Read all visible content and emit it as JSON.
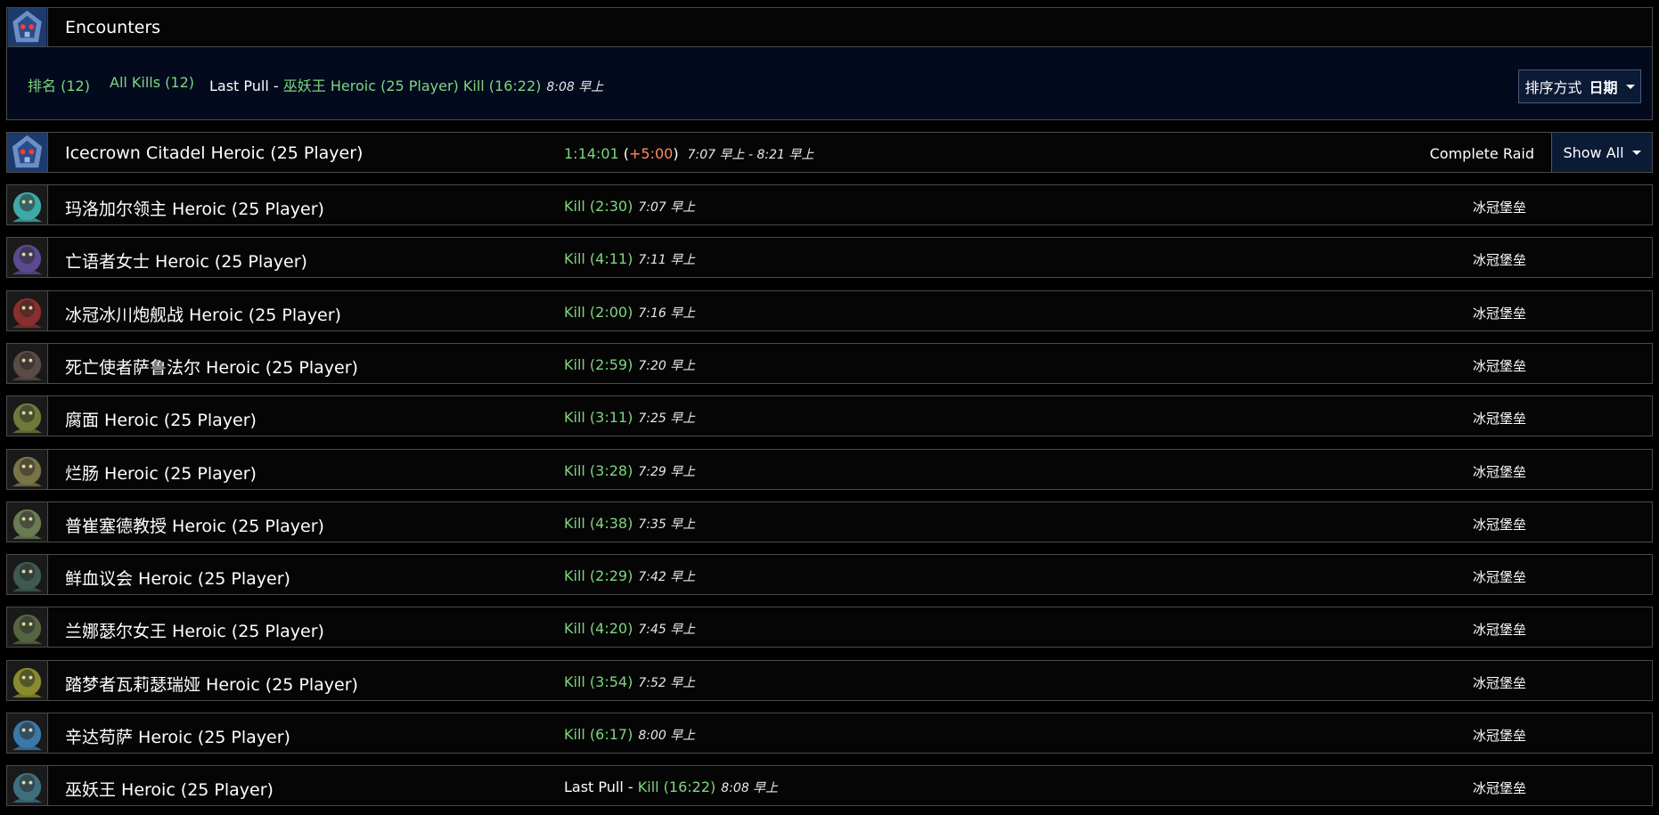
{
  "header": {
    "title": "Encounters",
    "icon": "icecrown-citadel-icon"
  },
  "filter": {
    "rank_tab": "排名 (12)",
    "all_kills_tab": "All Kills (12)",
    "last_pull_label": "Last Pull",
    "last_pull_sep": " - ",
    "last_pull_result": "巫妖王 Heroic (25 Player) Kill (16:22)",
    "last_pull_time": "8:08 早上",
    "sort_label": "排序方式",
    "sort_value": "日期"
  },
  "raid": {
    "name": "Icecrown Citadel Heroic (25 Player)",
    "duration": "1:14:01",
    "paren_open": " (",
    "penalty": "+5:00",
    "paren_close": ")",
    "time_range": "7:07 早上 -  8:21 早上",
    "complete_label": "Complete Raid",
    "show_all_label": "Show All"
  },
  "colors": {
    "kill_green": "#7fd67f",
    "penalty_red": "#ff8a5c",
    "panel_navy": "#030a1e",
    "button_navy": "#0b1a35",
    "border": "#4a4a4a"
  },
  "encounters": [
    {
      "name": "玛洛加尔领主 Heroic (25 Player)",
      "result": "Kill (2:30)",
      "time": "7:07 早上",
      "zone": "冰冠堡垒",
      "icon": "boss-marrowgar-icon",
      "hue": "#3fa9a8"
    },
    {
      "name": "亡语者女士 Heroic (25 Player)",
      "result": "Kill (4:11)",
      "time": "7:11 早上",
      "zone": "冰冠堡垒",
      "icon": "boss-deathwhisper-icon",
      "hue": "#5b4a8f"
    },
    {
      "name": "冰冠冰川炮舰战 Heroic (25 Player)",
      "result": "Kill (2:00)",
      "time": "7:16 早上",
      "zone": "冰冠堡垒",
      "icon": "boss-gunship-icon",
      "hue": "#8a2e2e"
    },
    {
      "name": "死亡使者萨鲁法尔 Heroic (25 Player)",
      "result": "Kill (2:59)",
      "time": "7:20 早上",
      "zone": "冰冠堡垒",
      "icon": "boss-saurfang-icon",
      "hue": "#5a4b45"
    },
    {
      "name": "腐面 Heroic (25 Player)",
      "result": "Kill (3:11)",
      "time": "7:25 早上",
      "zone": "冰冠堡垒",
      "icon": "boss-festergut-icon",
      "hue": "#6e7a3a"
    },
    {
      "name": "烂肠 Heroic (25 Player)",
      "result": "Kill (3:28)",
      "time": "7:29 早上",
      "zone": "冰冠堡垒",
      "icon": "boss-rotface-icon",
      "hue": "#7a7347"
    },
    {
      "name": "普崔塞德教授 Heroic (25 Player)",
      "result": "Kill (4:38)",
      "time": "7:35 早上",
      "zone": "冰冠堡垒",
      "icon": "boss-putricide-icon",
      "hue": "#6a7a52"
    },
    {
      "name": "鲜血议会 Heroic (25 Player)",
      "result": "Kill (2:29)",
      "time": "7:42 早上",
      "zone": "冰冠堡垒",
      "icon": "boss-blood-council-icon",
      "hue": "#3e5a4f"
    },
    {
      "name": "兰娜瑟尔女王 Heroic (25 Player)",
      "result": "Kill (4:20)",
      "time": "7:45 早上",
      "zone": "冰冠堡垒",
      "icon": "boss-lanathel-icon",
      "hue": "#56653f"
    },
    {
      "name": "踏梦者瓦莉瑟瑞娅 Heroic (25 Player)",
      "result": "Kill (3:54)",
      "time": "7:52 早上",
      "zone": "冰冠堡垒",
      "icon": "boss-valithria-icon",
      "hue": "#8a8a2e"
    },
    {
      "name": "辛达苟萨 Heroic (25 Player)",
      "result": "Kill (6:17)",
      "time": "8:00 早上",
      "zone": "冰冠堡垒",
      "icon": "boss-sindragosa-icon",
      "hue": "#3a78a8"
    },
    {
      "name": "巫妖王 Heroic (25 Player)",
      "prefix": "Last Pull - ",
      "result": "Kill (16:22)",
      "time": "8:08 早上",
      "zone": "冰冠堡垒",
      "icon": "boss-lich-king-icon",
      "hue": "#3f6f7f"
    }
  ]
}
